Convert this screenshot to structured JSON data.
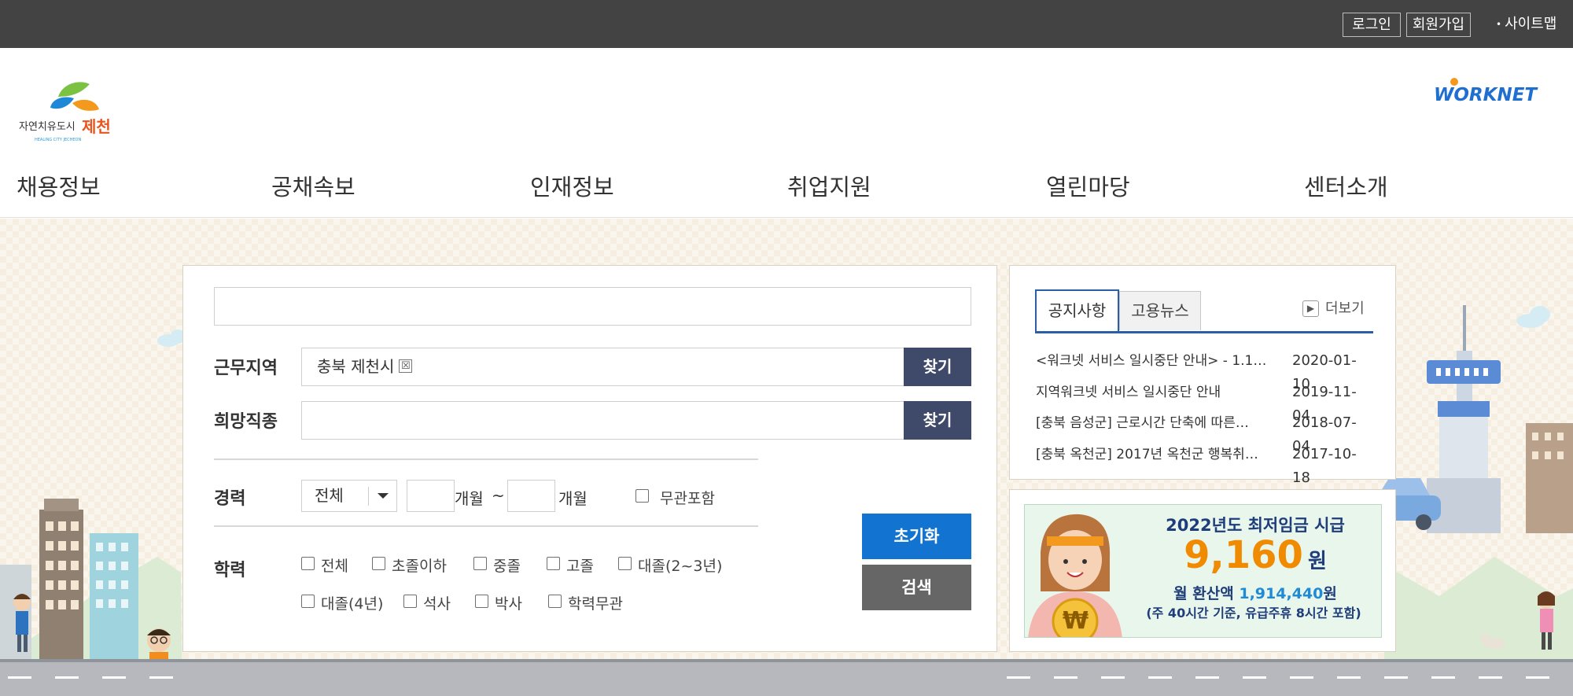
{
  "topbar": {
    "login": "로그인",
    "join": "회원가입",
    "sitemap": "사이트맵"
  },
  "header": {
    "logo_text": "자연치유도시",
    "logo_city": "제천",
    "logo_sub": "HEALING CITY JECHEON",
    "workmark_text": "WORKNET"
  },
  "nav": [
    "채용정보",
    "공채속보",
    "인재정보",
    "취업지원",
    "열린마당",
    "센터소개"
  ],
  "search": {
    "keyword_value": "",
    "region_label": "근무지역",
    "region_value": "충북 제천시",
    "remove_mark": "☒",
    "find_label": "찾기",
    "job_label": "희망직종",
    "career_label": "경력",
    "career_select": "전체",
    "month_unit": "개월",
    "tilde": "~",
    "career_irrelevant": "무관포함",
    "edu_label": "학력",
    "edu_options": [
      "전체",
      "초졸이하",
      "중졸",
      "고졸",
      "대졸(2~3년)",
      "대졸(4년)",
      "석사",
      "박사",
      "학력무관"
    ],
    "reset": "초기화",
    "submit": "검색"
  },
  "notice": {
    "tabs": [
      "공지사항",
      "고용뉴스"
    ],
    "active_tab": "공지사항",
    "more": "더보기",
    "items": [
      {
        "title": "<워크넷 서비스 일시중단 안내> - 1.1…",
        "date": "2020-01-10"
      },
      {
        "title": "지역워크넷 서비스 일시중단 안내",
        "date": "2019-11-04"
      },
      {
        "title": "[충북 음성군] 근로시간 단축에 따른…",
        "date": "2018-07-04"
      },
      {
        "title": "[충북 옥천군] 2017년 옥천군 행복취…",
        "date": "2017-10-18"
      }
    ]
  },
  "banner": {
    "title": "2022년도 최저임금 시급",
    "amount": "9,160",
    "amount_unit": "원",
    "monthly_prefix": "월 환산액",
    "monthly_value": "1,914,440",
    "monthly_unit": "원",
    "note": "(주 40시간 기준, 유급주휴 8시간 포함)",
    "coin_symbol": "₩"
  },
  "colors": {
    "topbar": "#434343",
    "find_button": "#3f4a6b",
    "reset_button": "#1273d0",
    "search_button": "#666666",
    "tab_accent": "#2a5fa8",
    "banner_amount": "#f08a00",
    "background": "#f6eee0"
  }
}
